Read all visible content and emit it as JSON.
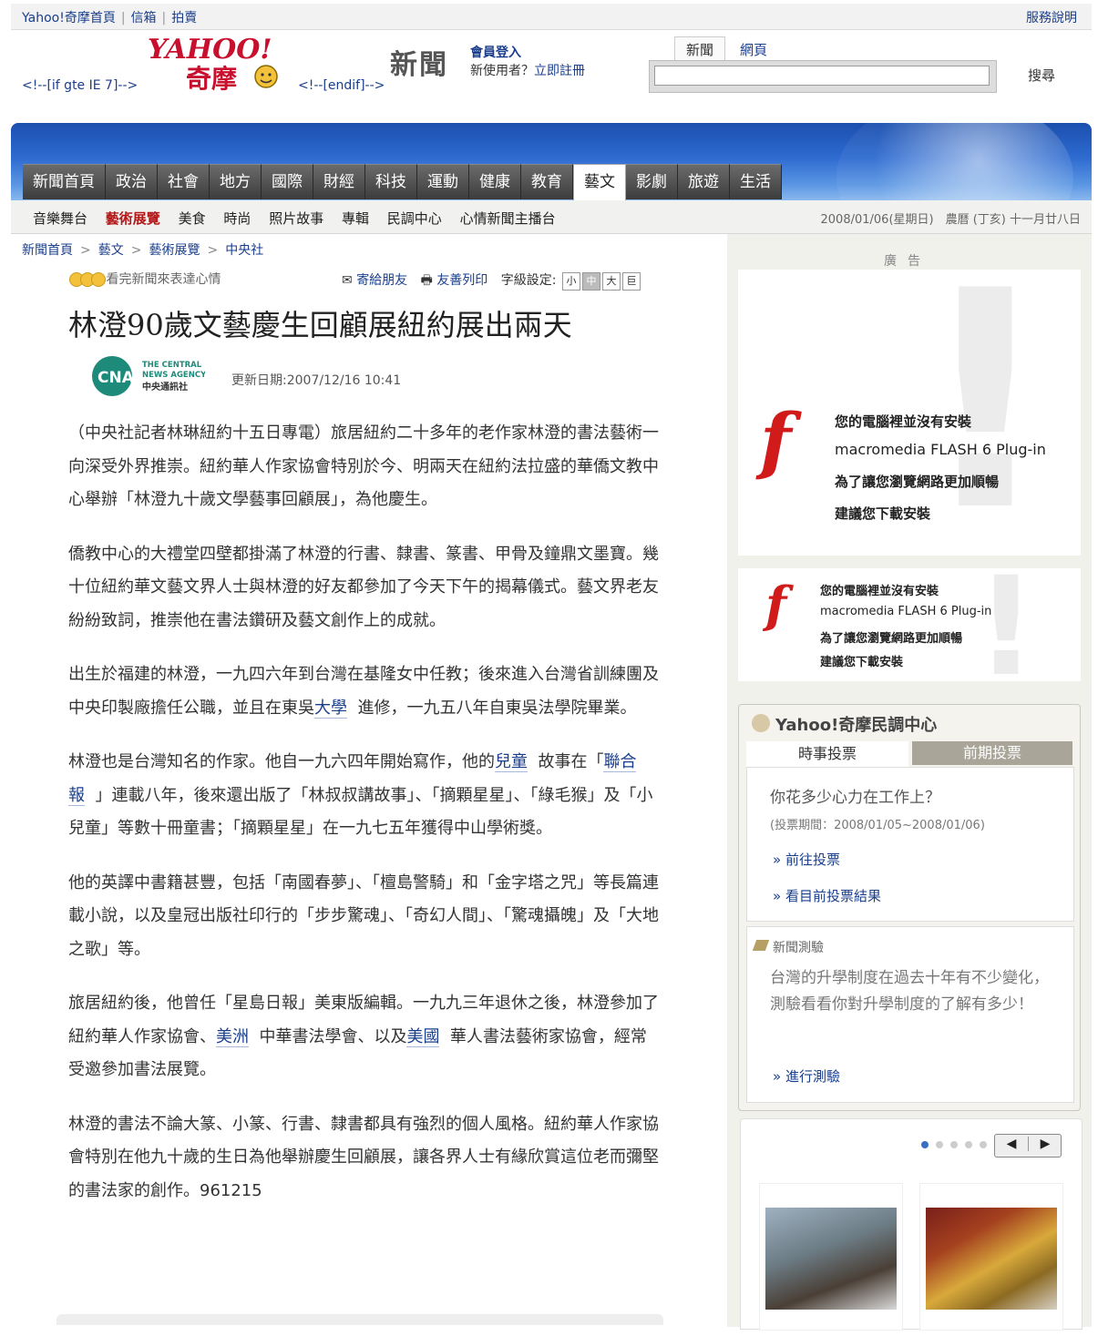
{
  "topbar": {
    "links": [
      "Yahoo!奇摩首頁",
      "信箱",
      "拍賣"
    ],
    "help": "服務說明"
  },
  "header": {
    "ie_open": "<!--[if gte IE 7]-->",
    "ie_close": "<!--[endif]-->",
    "section": "新聞",
    "member_login": "會員登入",
    "new_user": "新使用者？",
    "register": "立即註冊",
    "search_tabs": [
      "新聞",
      "網頁"
    ],
    "search_button": "搜尋",
    "search_value": ""
  },
  "nav": {
    "tabs": [
      "新聞首頁",
      "政治",
      "社會",
      "地方",
      "國際",
      "財經",
      "科技",
      "運動",
      "健康",
      "教育",
      "藝文",
      "影劇",
      "旅遊",
      "生活"
    ],
    "active": "藝文",
    "sub": [
      "音樂舞台",
      "藝術展覽",
      "美食",
      "時尚",
      "照片故事",
      "專輯",
      "民調中心",
      "心情新聞主播台"
    ],
    "sub_active": "藝術展覽",
    "date": "2008/01/06(星期日)　農曆 (丁亥) 十一月廿八日"
  },
  "breadcrumb": [
    "新聞首頁",
    "藝文",
    "藝術展覽",
    "中央社"
  ],
  "article_tools": {
    "mood": "看完新聞來表達心情",
    "send": "寄給朋友",
    "print": "友善列印",
    "font_label": "字級設定:",
    "font_sizes": [
      "小",
      "中",
      "大",
      "巨"
    ]
  },
  "article": {
    "title": "林澄90歲文藝慶生回顧展紐約展出兩天",
    "source_logo": [
      "THE CENTRAL",
      "NEWS AGENCY",
      "中央通訊社"
    ],
    "updated": "更新日期:2007/12/16 10:41",
    "p1": "（中央社記者林琳紐約十五日專電）旅居紐約二十多年的老作家林澄的書法藝術一向深受外界推崇。紐約華人作家協會特別於今、明兩天在紐約法拉盛的華僑文教中心舉辦「林澄九十歲文學藝事回顧展」，為他慶生。",
    "p2": "僑教中心的大禮堂四壁都掛滿了林澄的行書、隸書、篆書、甲骨及鐘鼎文墨寶。幾十位紐約華文藝文界人士與林澄的好友都參加了今天下午的揭幕儀式。藝文界老友紛紛致詞，推崇他在書法鑽研及藝文創作上的成就。",
    "p3a": "出生於福建的林澄，一九四六年到台灣在基隆女中任教；後來進入台灣省訓練團及中央印製廠擔任公職，並且在東吳",
    "p3kw": "大學",
    "p3b": "進修，一九五八年自東吳法學院畢業。",
    "p4a": "林澄也是台灣知名的作家。他自一九六四年開始寫作，他的",
    "p4kw1": "兒童",
    "p4b": "故事在「",
    "p4kw2": "聯合報",
    "p4c": "」連載八年，後來還出版了「林叔叔講故事」、「摘顆星星」、「綠毛猴」及「小兒童」等數十冊童書；「摘顆星星」在一九七五年獲得中山學術獎。",
    "p5": "他的英譯中書籍甚豐，包括「南國春夢」、「檀島警騎」和「金字塔之咒」等長篇連載小說，以及皇冠出版社印行的「步步驚魂」、「奇幻人間」、「驚魂攝魄」及「大地之歌」等。",
    "p6a": "旅居紐約後，他曾任「星島日報」美東版編輯。一九九三年退休之後，林澄參加了紐約華人作家協會、",
    "p6kw1": "美洲",
    "p6b": "中華書法學會、以及",
    "p6kw2": "美國",
    "p6c": "華人書法藝術家協會，經常受邀參加書法展覽。",
    "p7": "林澄的書法不論大篆、小篆、行書、隸書都具有強烈的個人風格。紐約華人作家協會特別在他九十歲的生日為他舉辦慶生回顧展，讓各界人士有緣欣賞這位老而彌堅的書法家的創作。961215"
  },
  "sidebar": {
    "ad_label": "廣告",
    "flash_lines": [
      "您的電腦裡並沒有安裝",
      "macromedia FLASH 6 Plug-in",
      "為了讓您瀏覽網路更加順暢",
      "建議您下載安裝"
    ],
    "poll": {
      "title": "Yahoo!奇摩民調中心",
      "tab_current": "時事投票",
      "tab_past": "前期投票",
      "question": "你花多少心力在工作上？",
      "period": "(投票期間：2008/01/05~2008/01/06)",
      "link_vote": "» 前往投票",
      "link_result": "» 看目前投票結果",
      "quiz_title": "新聞測驗",
      "quiz_text": "台灣的升學制度在過去十年有不少變化，測驗看看你對升學制度的了解有多少！",
      "quiz_link": "» 進行測驗"
    },
    "carousel": {
      "prev": "◀",
      "next": "▶"
    }
  }
}
